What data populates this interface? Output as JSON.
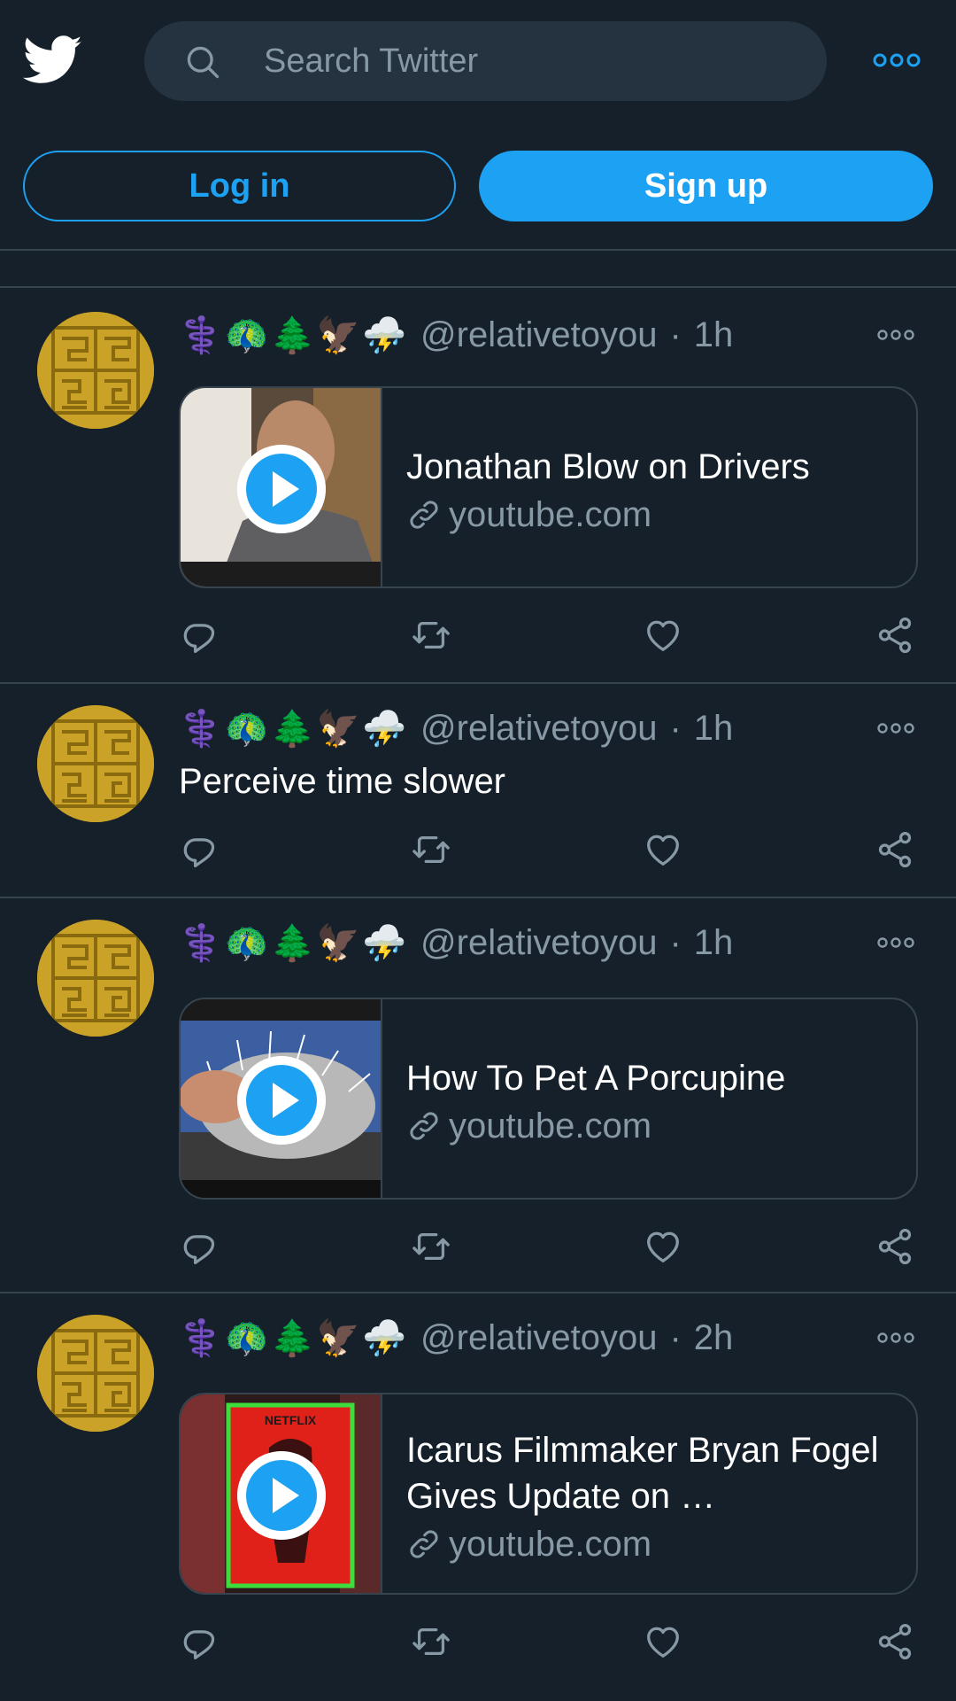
{
  "header": {
    "search_placeholder": "Search Twitter"
  },
  "auth": {
    "login_label": "Log in",
    "signup_label": "Sign up"
  },
  "colors": {
    "background": "#15202b",
    "accent": "#1da1f2",
    "secondary_text": "#8899a6",
    "divider": "#38444d"
  },
  "tweets": [
    {
      "emojis": "⚕️🦚🌲🦅⛈️",
      "handle": "@relativetoyou",
      "separator": "·",
      "time": "1h",
      "card": {
        "title": "Jonathan Blow on Drivers",
        "domain": "youtube.com"
      }
    },
    {
      "emojis": "⚕️🦚🌲🦅⛈️",
      "handle": "@relativetoyou",
      "separator": "·",
      "time": "1h",
      "text": "Perceive time slower"
    },
    {
      "emojis": "⚕️🦚🌲🦅⛈️",
      "handle": "@relativetoyou",
      "separator": "·",
      "time": "1h",
      "card": {
        "title": "How To Pet A Porcupine",
        "domain": "youtube.com"
      }
    },
    {
      "emojis": "⚕️🦚🌲🦅⛈️",
      "handle": "@relativetoyou",
      "separator": "·",
      "time": "2h",
      "card": {
        "title": "Icarus Filmmaker Bryan Fogel Gives Update on …",
        "domain": "youtube.com",
        "thumb_brand": "NETFLIX"
      }
    }
  ]
}
